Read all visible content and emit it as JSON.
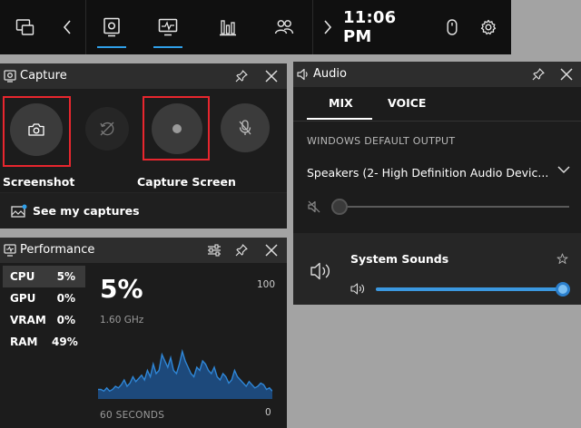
{
  "topbar": {
    "time": "11:06 PM",
    "icons": [
      "widget-menu-icon",
      "chevron-left-icon",
      "capture-widget-icon",
      "performance-widget-icon",
      "resources-widget-icon",
      "xbox-social-icon",
      "chevron-right-icon",
      "mouse-icon",
      "gear-icon"
    ],
    "accent": "#2f9fe8"
  },
  "capture": {
    "title": "Capture",
    "screenshot_label": "Screenshot",
    "capture_screen_label": "Capture Screen",
    "see_captures_label": "See my captures",
    "highlight": "#e8262e"
  },
  "performance": {
    "title": "Performance",
    "items": [
      {
        "name": "CPU",
        "value": "5%"
      },
      {
        "name": "GPU",
        "value": "0%"
      },
      {
        "name": "VRAM",
        "value": "0%"
      },
      {
        "name": "RAM",
        "value": "49%"
      }
    ],
    "big_value": "5%",
    "frequency": "1.60 GHz",
    "max": "100",
    "min": "0",
    "duration": "60 SECONDS",
    "graph_color": "#2f86d6",
    "graph_values": [
      6,
      6,
      5,
      7,
      5,
      6,
      8,
      7,
      9,
      12,
      8,
      10,
      14,
      11,
      13,
      15,
      12,
      18,
      14,
      22,
      16,
      18,
      28,
      24,
      20,
      26,
      18,
      16,
      22,
      30,
      24,
      20,
      16,
      14,
      20,
      18,
      24,
      22,
      18,
      16,
      20,
      14,
      12,
      16,
      14,
      10,
      12,
      18,
      14,
      12,
      10,
      8,
      11,
      9,
      7,
      8,
      10,
      9,
      6,
      7,
      5
    ]
  },
  "audio": {
    "title": "Audio",
    "tabs": [
      "MIX",
      "VOICE"
    ],
    "output_label": "WINDOWS DEFAULT OUTPUT",
    "device": "Speakers (2- High Definition Audio Devic...",
    "master_volume": 0,
    "app_name": "System Sounds",
    "app_volume": 100
  }
}
